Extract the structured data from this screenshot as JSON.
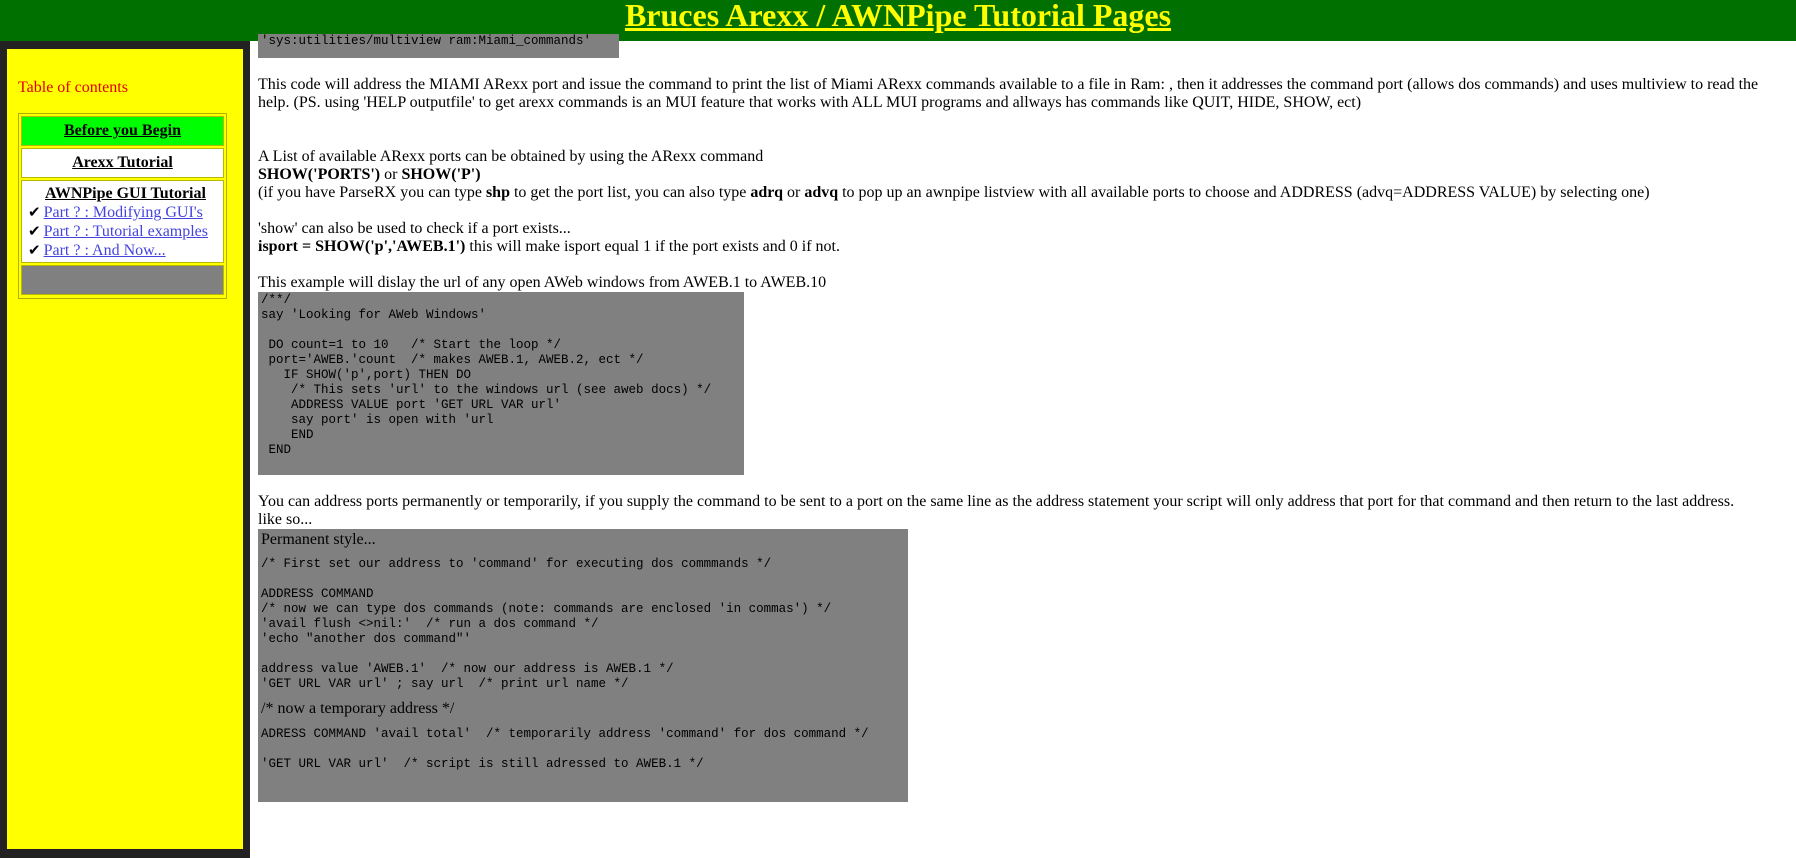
{
  "header": {
    "title": "Bruces Arexx / AWNPipe Tutorial Pages"
  },
  "sidebar": {
    "toc_title": "Table of contents",
    "before": "Before you Begin",
    "arexx": "Arexx Tutorial",
    "gui_title": "AWNPipe GUI Tutorial",
    "gui_links": [
      "Part ? : Modifying GUI's",
      "Part ? : Tutorial examples",
      "Part ? : And Now..."
    ],
    "tick": "✔"
  },
  "main": {
    "code_top": "'sys:utilities/multiview ram:Miami_commands'",
    "para1": "This code will address the MIAMI ARexx port and issue the command to print the list of Miami ARexx commands available to a file in Ram: , then it addresses the command port (allows dos commands) and uses multiview to read the help. (PS. using 'HELP outputfile' to get arexx commands is an MUI feature that works with ALL MUI programs and allways has commands like QUIT, HIDE, SHOW, ect)",
    "ports_intro": "A List of available ARexx ports can be obtained by using the ARexx command",
    "show_ports": "SHOW('PORTS')",
    "or": " or ",
    "show_p": "SHOW('P')",
    "parserx_1": "(if you have ParseRX you can type ",
    "shp": "shp",
    "parserx_2": " to get the port list, you can also type ",
    "adrq": "adrq",
    "or2": " or ",
    "advq": "advq",
    "parserx_3": " to pop up an awnpipe listview with all available ports to choose and ADDRESS (advq=ADDRESS VALUE) by selecting one)",
    "show_check": "'show' can also be used to check if a port exists...",
    "isport_code": "isport = SHOW('p','AWEB.1')",
    "isport_text": " this will make isport equal 1 if the port exists and 0 if not.",
    "example_intro": "This example will dislay the url of any open AWeb windows from AWEB.1 to AWEB.10",
    "code_aweb": "/**/\nsay 'Looking for AWeb Windows'\n\n DO count=1 to 10   /* Start the loop */\n port='AWEB.'count  /* makes AWEB.1, AWEB.2, ect */\n   IF SHOW('p',port) THEN DO\n    /* This sets 'url' to the windows url (see aweb docs) */\n    ADDRESS VALUE port 'GET URL VAR url'\n    say port' is open with 'url\n    END\n END",
    "address_para": "You can address ports permanently or temporarily, if you supply the command to be sent to a port on the same line as the address statement your script will only address that port for that command and then return to the last address.",
    "like_so": "like so...",
    "perm_title": "Permanent style...",
    "code_perm1": "/* First set our address to 'command' for executing dos commmands */\n\nADDRESS COMMAND\n/* now we can type dos commands (note: commands are enclosed 'in commas') */\n'avail flush <>nil:'  /* run a dos command */\n'echo \"another dos command\"'\n\naddress value 'AWEB.1'  /* now our address is AWEB.1 */\n'GET URL VAR url' ; say url  /* print url name */",
    "temp_title": "/* now a temporary address */",
    "code_temp1": "ADRESS COMMAND 'avail total'  /* temporarily address 'command' for dos command */",
    "code_temp2": "'GET URL VAR url'  /* script is still adressed to AWEB.1 */"
  }
}
